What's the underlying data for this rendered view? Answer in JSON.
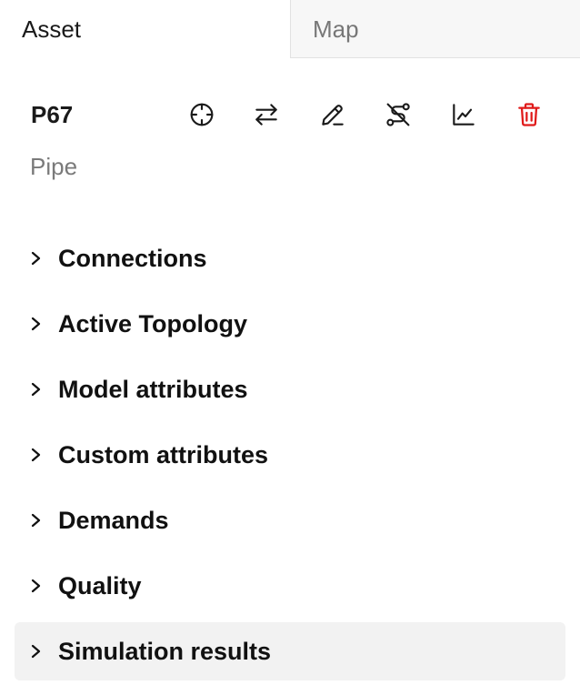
{
  "tabs": [
    {
      "label": "Asset",
      "active": true
    },
    {
      "label": "Map",
      "active": false
    }
  ],
  "asset": {
    "id": "P67",
    "type": "Pipe"
  },
  "toolbar": {
    "icons": [
      {
        "name": "crosshair-icon"
      },
      {
        "name": "swap-icon"
      },
      {
        "name": "edit-icon"
      },
      {
        "name": "route-off-icon"
      },
      {
        "name": "chart-line-icon"
      },
      {
        "name": "trash-icon",
        "color": "#e01a1a"
      }
    ]
  },
  "sections": [
    {
      "label": "Connections"
    },
    {
      "label": "Active Topology"
    },
    {
      "label": "Model attributes"
    },
    {
      "label": "Custom attributes"
    },
    {
      "label": "Demands"
    },
    {
      "label": "Quality"
    },
    {
      "label": "Simulation results",
      "highlighted": true
    }
  ],
  "colors": {
    "danger": "#e01a1a",
    "highlight_bg": "#f2f2f2",
    "muted_text": "#7a7a7a"
  }
}
